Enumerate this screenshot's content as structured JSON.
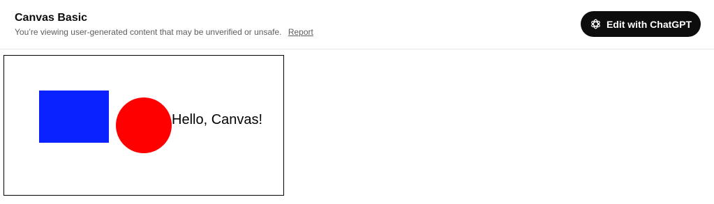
{
  "header": {
    "title": "Canvas Basic",
    "notice": "You’re viewing user-generated content that may be unverified or unsafe.",
    "report_label": "Report",
    "edit_button_label": "Edit with ChatGPT",
    "edit_button_icon": "chatgpt-logo-icon"
  },
  "canvas": {
    "rectangle_color": "#0a22ff",
    "circle_color": "#ff0000",
    "text": "Hello, Canvas!"
  }
}
